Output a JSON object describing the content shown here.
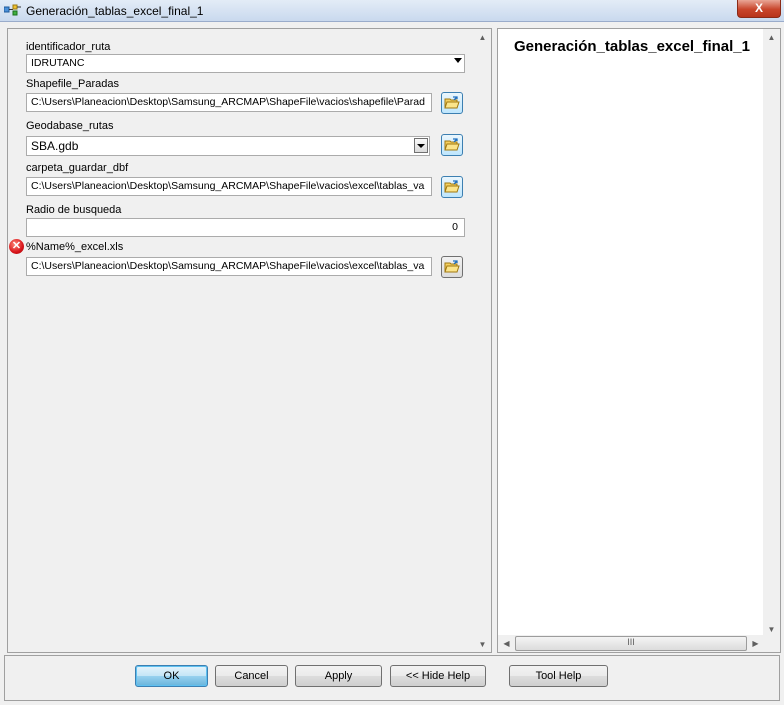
{
  "window": {
    "title": "Generación_tablas_excel_final_1",
    "close_label": "X"
  },
  "fields": {
    "identificador_ruta": {
      "label": "identificador_ruta",
      "value": "IDRUTANC"
    },
    "shapefile_paradas": {
      "label": "Shapefile_Paradas",
      "value": "C:\\Users\\Planeacion\\Desktop\\Samsung_ARCMAP\\ShapeFile\\vacios\\shapefile\\Parad"
    },
    "geodatabase_rutas": {
      "label": "Geodabase_rutas",
      "value": "SBA.gdb"
    },
    "carpeta_guardar_dbf": {
      "label": "carpeta_guardar_dbf",
      "value": "C:\\Users\\Planeacion\\Desktop\\Samsung_ARCMAP\\ShapeFile\\vacios\\excel\\tablas_va"
    },
    "radio_busqueda": {
      "label": "Radio de busqueda",
      "value": "0"
    },
    "name_excel": {
      "label": "%Name%_excel.xls",
      "value": "C:\\Users\\Planeacion\\Desktop\\Samsung_ARCMAP\\ShapeFile\\vacios\\excel\\tablas_va"
    }
  },
  "help": {
    "title": "Generación_tablas_excel_final_1",
    "scroll_grip": "III"
  },
  "buttons": {
    "ok": "OK",
    "cancel": "Cancel",
    "apply": "Apply",
    "hide_help": "<< Hide Help",
    "tool_help": "Tool Help"
  },
  "icons": {
    "app": "model-icon",
    "browse": "open-folder-icon",
    "error": "error-icon"
  }
}
